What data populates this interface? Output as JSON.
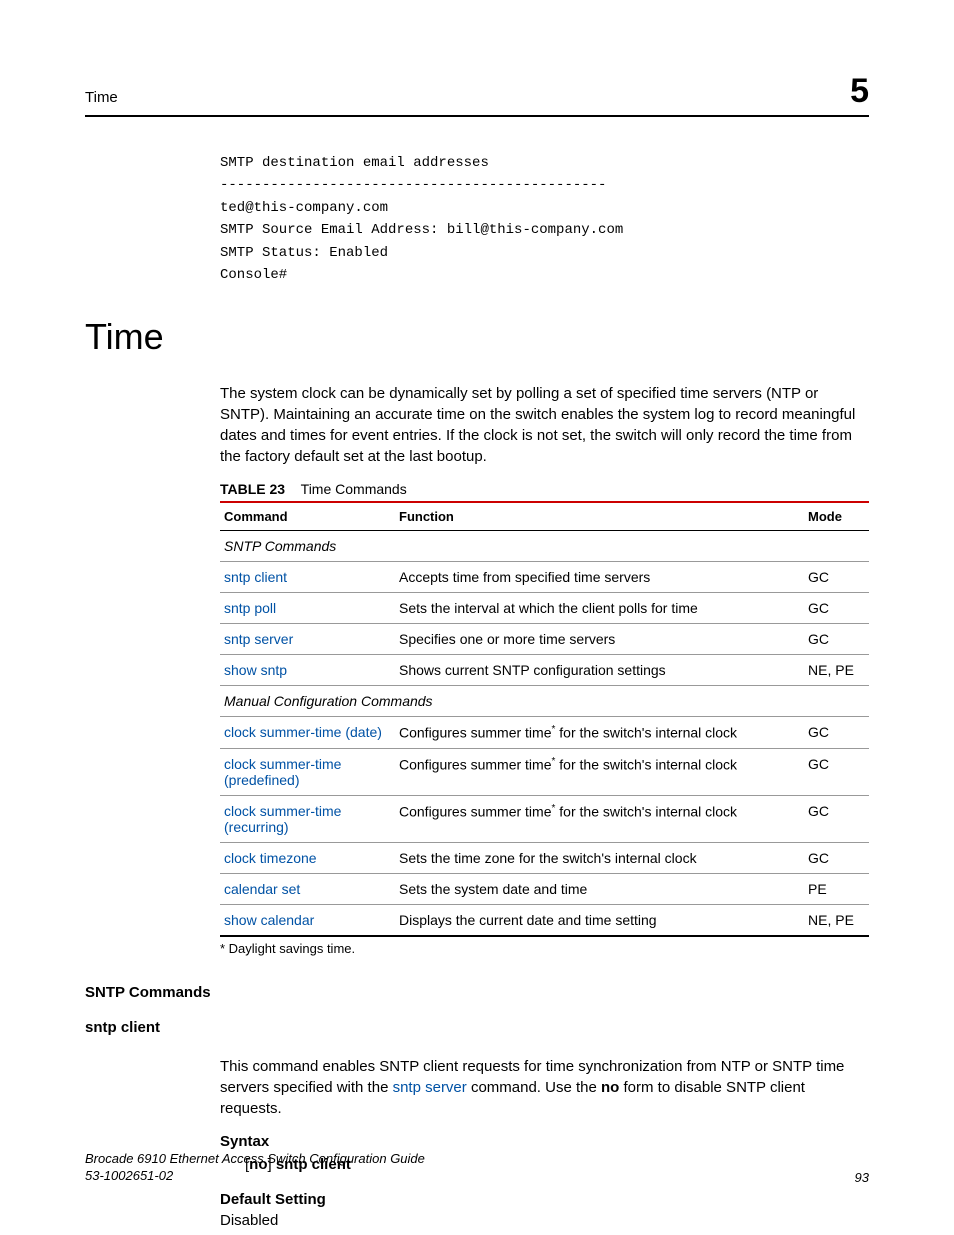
{
  "header": {
    "label": "Time",
    "chapter": "5"
  },
  "code_block": "SMTP destination email addresses\n----------------------------------------------\nted@this-company.com\nSMTP Source Email Address: bill@this-company.com\nSMTP Status: Enabled\nConsole#",
  "section_title": "Time",
  "intro_para": "The system clock can be dynamically set by polling a set of specified time servers (NTP or SNTP). Maintaining an accurate time on the switch enables the system log to record meaningful dates and times for event entries. If the clock is not set, the switch will only record the time from the factory default set at the last bootup.",
  "table": {
    "label": "TABLE 23",
    "title": "Time Commands",
    "headers": {
      "command": "Command",
      "function": "Function",
      "mode": "Mode"
    },
    "groups": [
      {
        "heading": "SNTP Commands",
        "rows": [
          {
            "cmd": "sntp client",
            "func": "Accepts time from specified time servers",
            "mode": "GC"
          },
          {
            "cmd": "sntp poll",
            "func": "Sets the interval at which the client polls for time",
            "mode": "GC"
          },
          {
            "cmd": "sntp server",
            "func": "Specifies one or more time servers",
            "mode": "GC"
          },
          {
            "cmd": "show sntp",
            "func": "Shows current SNTP configuration settings",
            "mode": "NE, PE"
          }
        ]
      },
      {
        "heading": "Manual Configuration Commands",
        "rows": [
          {
            "cmd": "clock summer-time (date)",
            "func_pre": "Configures summer time",
            "func_post": " for the switch's internal clock",
            "has_sup": true,
            "mode": "GC"
          },
          {
            "cmd": "clock summer-time (predefined)",
            "func_pre": "Configures summer time",
            "func_post": " for the switch's internal clock",
            "has_sup": true,
            "mode": "GC"
          },
          {
            "cmd": "clock summer-time (recurring)",
            "func_pre": "Configures summer time",
            "func_post": " for the switch's internal clock",
            "has_sup": true,
            "mode": "GC"
          },
          {
            "cmd": "clock timezone",
            "func": "Sets the time zone for the switch's internal clock",
            "mode": "GC"
          },
          {
            "cmd": "calendar set",
            "func": "Sets the system date and time",
            "mode": "PE"
          },
          {
            "cmd": "show calendar",
            "func": "Displays the current date and time setting",
            "mode": "NE, PE"
          }
        ]
      }
    ],
    "footnote": "*  Daylight savings time."
  },
  "sntp_section": {
    "heading": "SNTP Commands",
    "cmd_heading": "sntp client",
    "para_pre": "This command enables SNTP client requests for time synchronization from NTP or SNTP time servers specified with the ",
    "para_link": "sntp server",
    "para_mid": " command. Use the ",
    "para_bold": "no",
    "para_post": " form to disable SNTP client requests.",
    "syntax_label": "Syntax",
    "syntax_text_pre": "[",
    "syntax_text_bold1": "no",
    "syntax_text_mid": "] ",
    "syntax_text_bold2": "sntp client",
    "default_label": "Default Setting",
    "default_value": "Disabled"
  },
  "footer": {
    "line1": "Brocade 6910 Ethernet Access Switch Configuration Guide",
    "line2": "53-1002651-02",
    "page": "93"
  }
}
